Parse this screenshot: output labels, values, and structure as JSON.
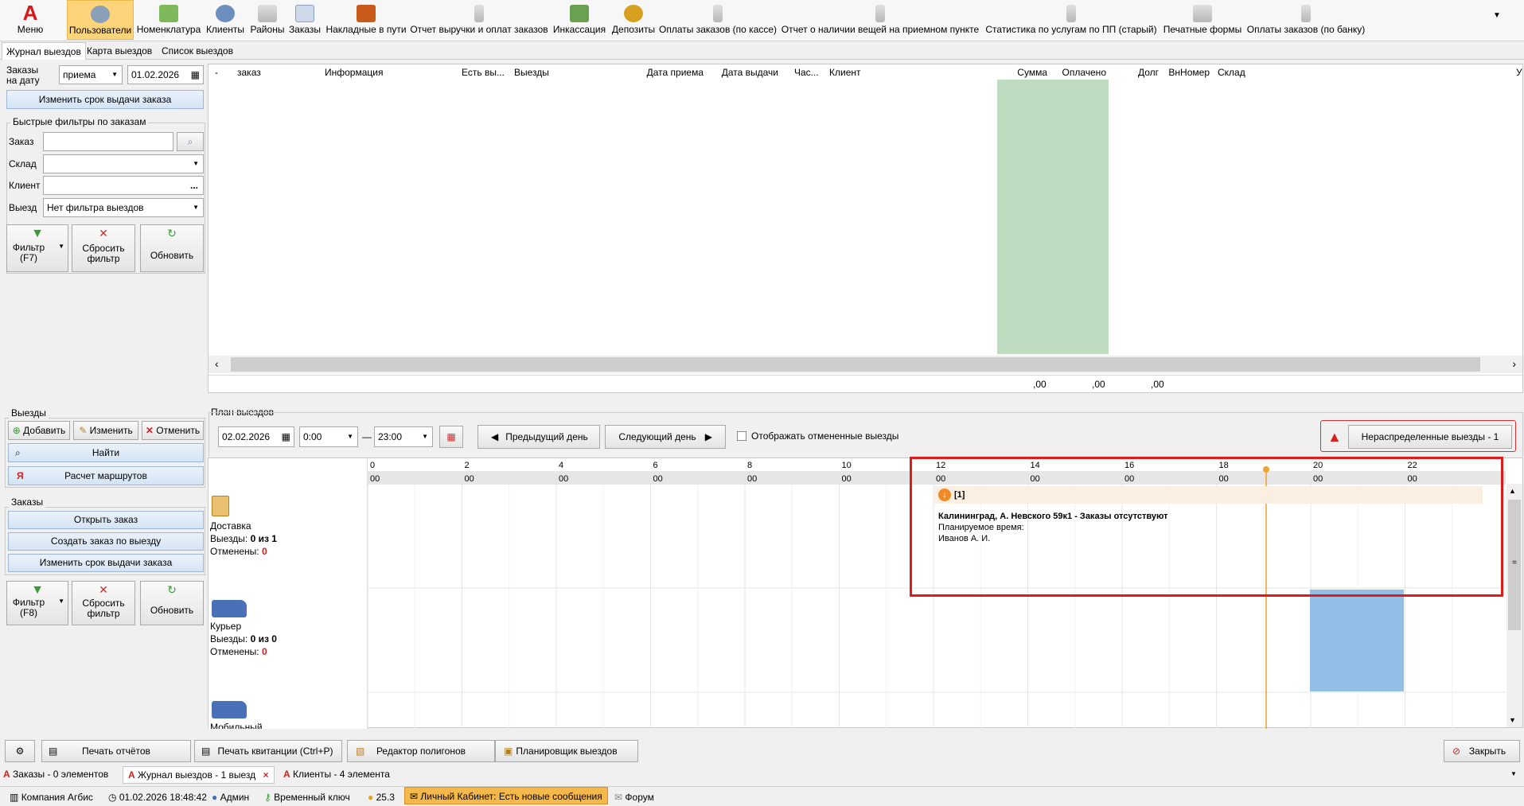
{
  "toolbar": {
    "menu": "Меню",
    "items": [
      "Пользователи",
      "Номенклатура",
      "Клиенты",
      "Районы",
      "Заказы",
      "Накладные в пути",
      "Отчет выручки и оплат заказов",
      "Инкассация",
      "Депозиты",
      "Оплаты заказов (по кассе)",
      "Отчет о наличии вещей на приемном пункте",
      "Статистика по услугам по ПП (старый)",
      "Печатные формы",
      "Оплаты заказов (по банку)"
    ]
  },
  "tabs": [
    "Журнал выездов",
    "Карта выездов",
    "Список выездов"
  ],
  "left": {
    "date_label": "Заказы на дату",
    "date_mode": "приема",
    "date_value": "01.02.2026",
    "change_term_btn": "Изменить срок выдачи заказа",
    "quick_filters_title": "Быстрые фильтры по заказам",
    "order_label": "Заказ",
    "warehouse_label": "Склад",
    "client_label": "Клиент",
    "trip_label": "Выезд",
    "trip_value": "Нет фильтра выездов",
    "client_dots": "...",
    "filter_btn": "Фильтр (F7)",
    "reset_btn": "Сбросить фильтр",
    "refresh_btn": "Обновить",
    "trips_title": "Выезды",
    "add_btn": "Добавить",
    "edit_btn": "Изменить",
    "cancel_btn": "Отменить",
    "find_btn": "Найти",
    "route_letter": "Я",
    "route_btn": "Расчет маршрутов",
    "orders_title": "Заказы",
    "open_order_btn": "Открыть заказ",
    "create_order_btn": "Создать заказ по выезду",
    "change_term_btn2": "Изменить срок выдачи заказа",
    "filter2_btn": "Фильтр (F8)",
    "reset2_btn": "Сбросить фильтр",
    "refresh2_btn": "Обновить"
  },
  "grid": {
    "headers": [
      "-",
      "заказ",
      "Информация",
      "Есть вы...",
      "Выезды",
      "Дата приема",
      "Дата выдачи",
      "Час...",
      "Клиент",
      "Сумма",
      "Оплачено",
      "Долг",
      "ВнНомер",
      "Склад",
      "У"
    ],
    "totals": [
      ",00",
      ",00",
      ",00"
    ]
  },
  "plan": {
    "title": "План выездов",
    "date": "02.02.2026",
    "from": "0:00",
    "dash": "—",
    "to": "23:00",
    "prev_btn": "Предыдущий день",
    "next_btn": "Следующий день",
    "show_cancelled": "Отображать отмененные выезды",
    "unassigned_btn": "Нераспределенные выезды - 1",
    "hours": [
      "0",
      "2",
      "4",
      "6",
      "8",
      "10",
      "12",
      "14",
      "16",
      "18",
      "20",
      "22"
    ],
    "minutes": "00",
    "rows": [
      {
        "name": "Доставка",
        "trips_label": "Выезды:",
        "trips": "0 из 1",
        "cancelled_label": "Отменены:",
        "cancelled": "0"
      },
      {
        "name": "Курьер",
        "trips_label": "Выезды:",
        "trips": "0 из 0",
        "cancelled_label": "Отменены:",
        "cancelled": "0"
      },
      {
        "name": "Мобильный"
      }
    ],
    "popup": {
      "count": "[1]",
      "address": "Калининград, А. Невского 59к1 - Заказы отсутствуют",
      "planned": "Планируемое время:",
      "person": "Иванов А. И."
    },
    "scroll_mid": "="
  },
  "bottom": {
    "print_reports": "Печать отчётов",
    "print_receipt": "Печать квитанции (Ctrl+P)",
    "polygon_editor": "Редактор полигонов",
    "planner": "Планировщик выездов",
    "close": "Закрыть"
  },
  "doc_tabs": [
    "Заказы - 0 элементов",
    "Журнал выездов - 1 выезд",
    "Клиенты - 4 элемента"
  ],
  "doc_tab_close": "×",
  "status": {
    "company": "Компания Агбис",
    "datetime": "01.02.2026 18:48:42",
    "user": "Админ",
    "key": "Временный ключ",
    "coins": "25.3",
    "cabinet": "Личный Кабинет: Есть новые сообщения",
    "forum": "Форум"
  }
}
